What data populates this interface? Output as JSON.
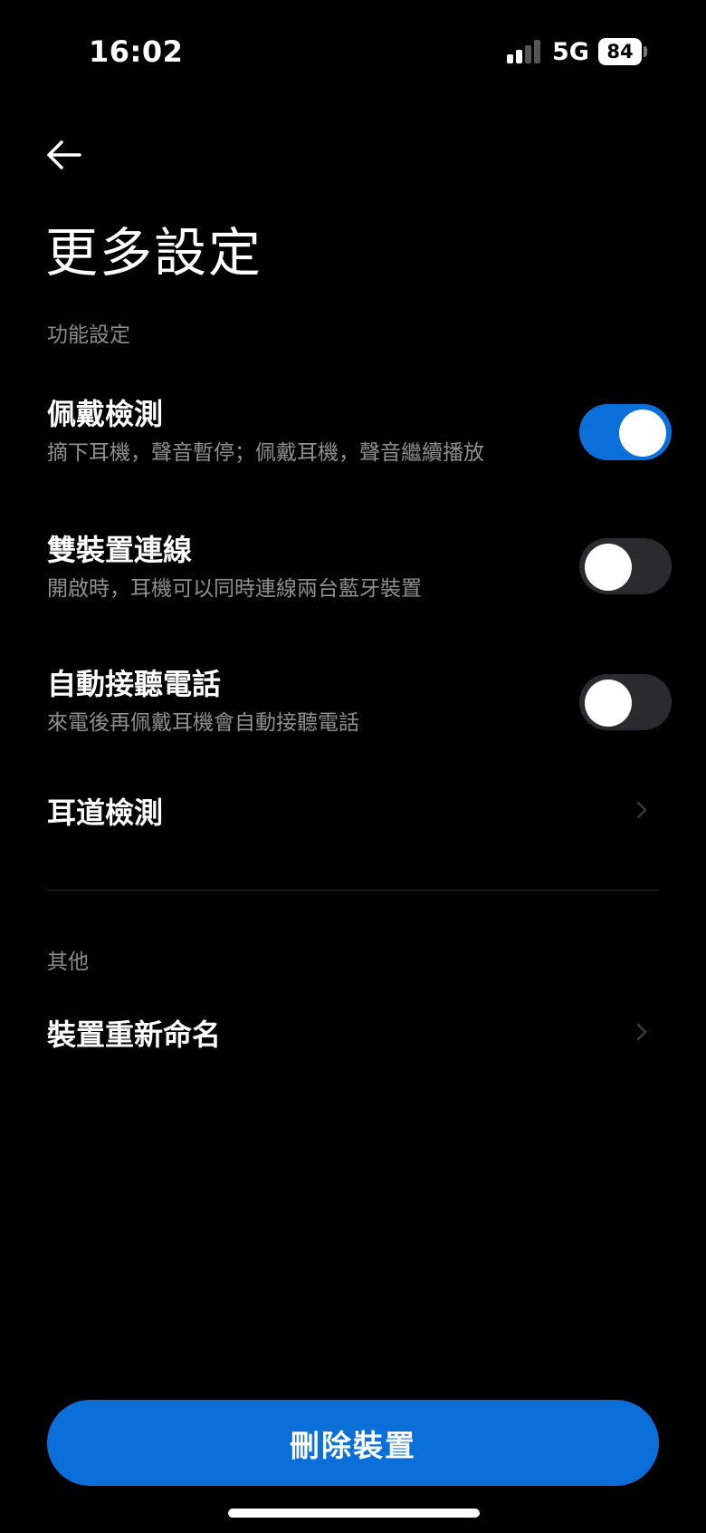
{
  "status_bar": {
    "time": "16:02",
    "network": "5G",
    "battery": "84"
  },
  "page": {
    "title": "更多設定"
  },
  "sections": {
    "features": {
      "header": "功能設定",
      "wear_detection": {
        "title": "佩戴檢測",
        "description": "摘下耳機，聲音暫停；佩戴耳機，聲音繼續播放",
        "enabled": true
      },
      "dual_connection": {
        "title": "雙裝置連線",
        "description": "開啟時，耳機可以同時連線兩台藍牙裝置",
        "enabled": false
      },
      "auto_answer": {
        "title": "自動接聽電話",
        "description": "來電後再佩戴耳機會自動接聽電話",
        "enabled": false
      },
      "ear_tip_test": {
        "title": "耳道檢測"
      }
    },
    "other": {
      "header": "其他",
      "rename_device": {
        "title": "裝置重新命名"
      }
    }
  },
  "actions": {
    "delete_device": "刪除裝置"
  },
  "colors": {
    "accent": "#0a6fd8",
    "background": "#000000",
    "toggle_off": "#2b2b2f",
    "secondary_text": "#8f8f8f"
  },
  "icons": {
    "back": "arrow-left-icon",
    "chevron": "chevron-right-icon"
  }
}
